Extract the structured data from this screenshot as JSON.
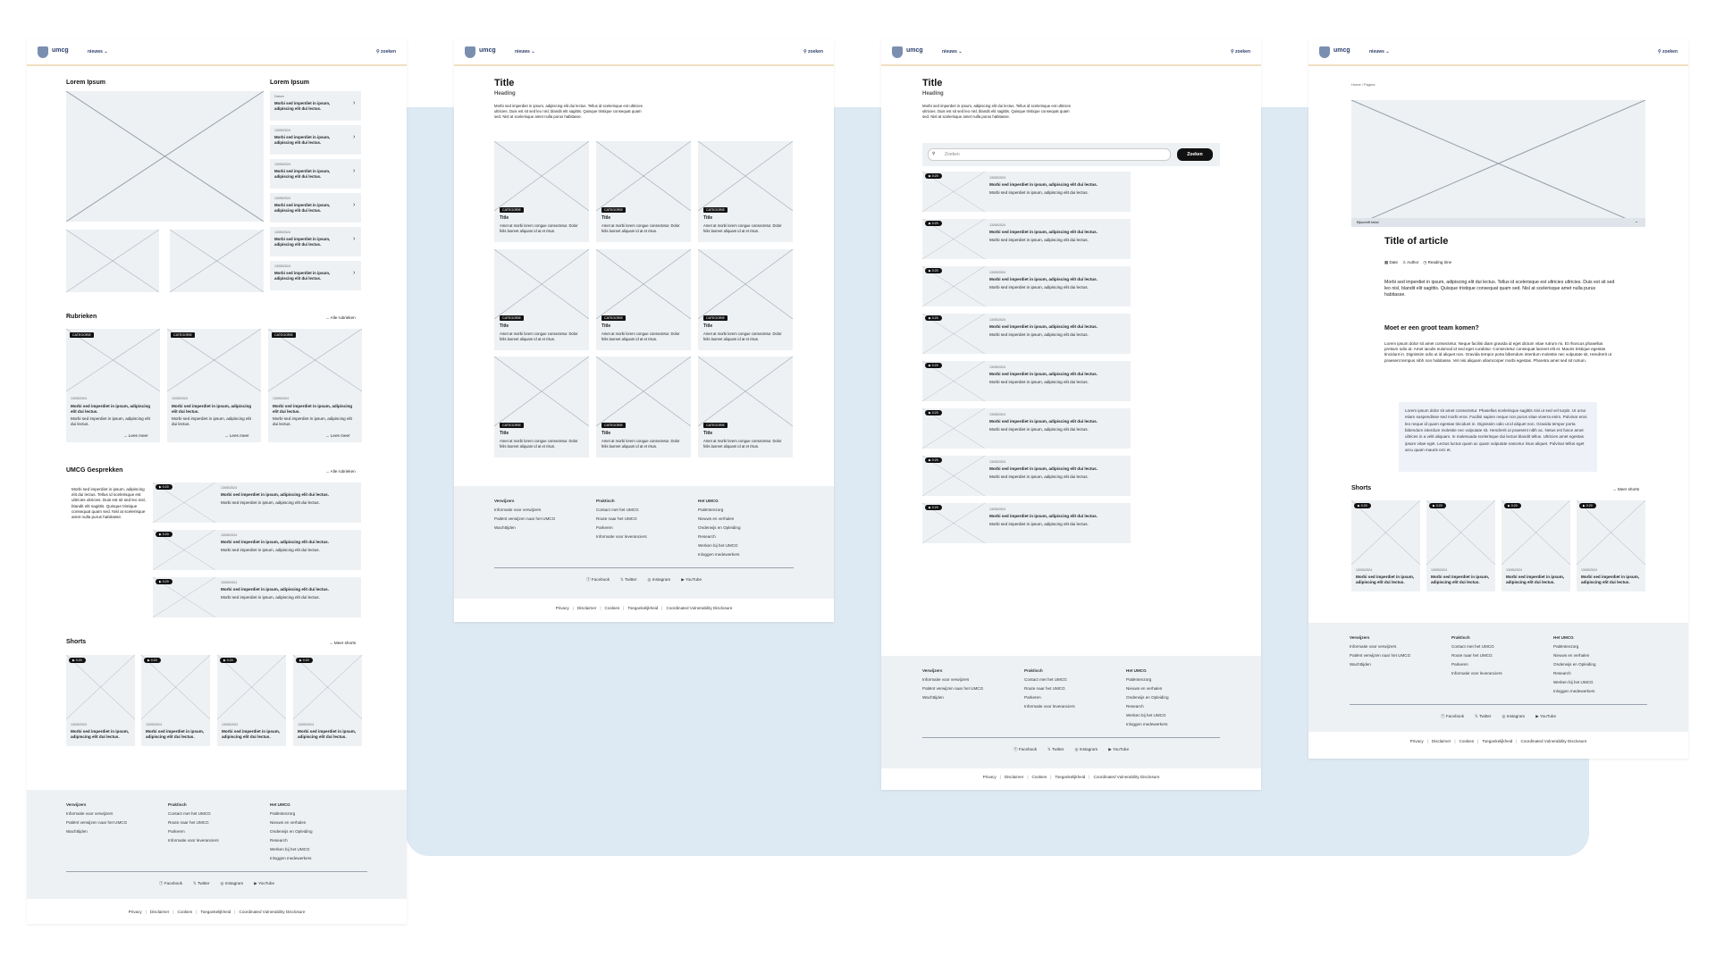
{
  "nav": {
    "brand": "umcg",
    "menu": "nieuws",
    "search": "zoeken"
  },
  "lorem": "Lorem Ipsum",
  "rubrieken": "Rubrieken",
  "alle_rubrieken": "Alle rubrieken",
  "gesprekken": "UMCG Gesprekken",
  "gesprekken_text": "Morbi sed imperdiet in ipsum, adipiscing elit dui lectus. Tellus id scelerisque est ultricies ultricies. Duis est sit sed leo nisl, blandit elit sagittis. Quisque tristique consequat quam sed. Nisl at scelerisque amet nulla purus habitasse.",
  "shorts": "Shorts",
  "meer_shorts": "Meer shorts",
  "date": "13/05/2024",
  "date_short": "Datum",
  "item_title": "Morbi sed imperdiet in ipsum, adipiscing elit dui lectus.",
  "item_sub": "Morbi sed imperdiet in ipsum, adipiscing elit dui lectus.",
  "lees_meer": "Lees meer",
  "categorie": "CATEGORIE",
  "duration": "0:20",
  "page_title": "Title",
  "page_heading": "Heading",
  "intro": "Morbi sed imperdiet in ipsum, adipiscing elit dui lectus. Tellus id scelerisque est ultricies ultricies. Duis est sit sed leo nisl, blandit elit sagittis. Quisque tristique consequat quam sed. Nisl at scelerisque amet nulla purus habitasse.",
  "card_title": "Title",
  "card_text": "Amet at morbi lorem congue consectetur. Dolor felis laoreet aliquam id at et risus.",
  "search_placeholder": "Zoeken",
  "search_button": "Zoeken",
  "breadcrumb": {
    "home": "Home",
    "sep": "/",
    "current": "Pagina"
  },
  "caption": "Bijschrift tekst",
  "article_title": "Title of article",
  "meta": {
    "date": "Date",
    "author": "Author",
    "reading": "Reading time"
  },
  "article_intro": "Morbi sed imperdiet in ipsum, adipiscing elit dui lectus. Tellus id scelerisque est ultricies ultricies. Duis est sit sed leo nisl, blandit elit sagittis. Quisque tristique consequat quam sed. Nisl at scelerisque amet nulla purus habitasse.",
  "article_h2": "Moet er een groot team komen?",
  "article_body": "Lorem ipsum dolor sit amet consectetur. Neque facilisi diam gravida id eget dictum vitae rutrum mi. Et rhoncus phasellus pretium odio at. Amet iaculis euismod id sed eget curabitur. Consectetur consequat laoreet elit et. Mauris tristique egestas tincidunt in. Dignissim odio ut id aliquet non. Gravida tempor porta bibendum interdum molestie nec vulputate sit. Hendrerit ut praesent tempus nibh non habitasse. Vel nisi aliquam ullamcorper morbi egestas. Pharetra amet sed sit rutrum.",
  "article_quote": "Lorem ipsum dolor sit amet consectetur. Phasellus scelerisque sagittis nisi ut sed vel turpis. Ut urna etiam suspendisse sed morbi eros. Facilisi sapien neque non purus vitae viverra enim. Pulvinar eros leo neque id quam egestas tincidunt in. Dignissim odio ut id aliquet non. Gravida tempor porta bibendum interdum molestie nec vulputate sit. Hendrerit ut praesent nibh ac. Netus est fusce amet ultrices in a velit aliquam. In malesuada scelerisque dui lectus blandit tellus. Ultricies amet egestas ipsum vitae eget. Lectus luctus quam ac quam vulputate nascetur risus aliquet. Pulvinar tellus eget arcu quam mauris orci et.",
  "footer": {
    "col1": {
      "title": "Verwijzers",
      "items": [
        "Informatie voor verwijzers",
        "Patiënt verwijzen naar het UMCG",
        "Wachttijden"
      ]
    },
    "col2": {
      "title": "Praktisch",
      "items": [
        "Contact met het UMCG",
        "Route naar het UMCG",
        "Parkeren",
        "Informatie voor leveranciers"
      ]
    },
    "col3": {
      "title": "Het UMCG",
      "items": [
        "Patiëntenzorg",
        "Nieuws en verhalen",
        "Onderwijs en Opleiding",
        "Research",
        "Werken bij het UMCG",
        "Inloggen medewerkers"
      ]
    },
    "social": [
      "Facebook",
      "Twitter",
      "Instagram",
      "YouTube"
    ],
    "legal": [
      "Privacy",
      "Disclaimer",
      "Cookies",
      "Toegankelijkheid",
      "Coordinated Vulnerability Disclosure"
    ]
  }
}
